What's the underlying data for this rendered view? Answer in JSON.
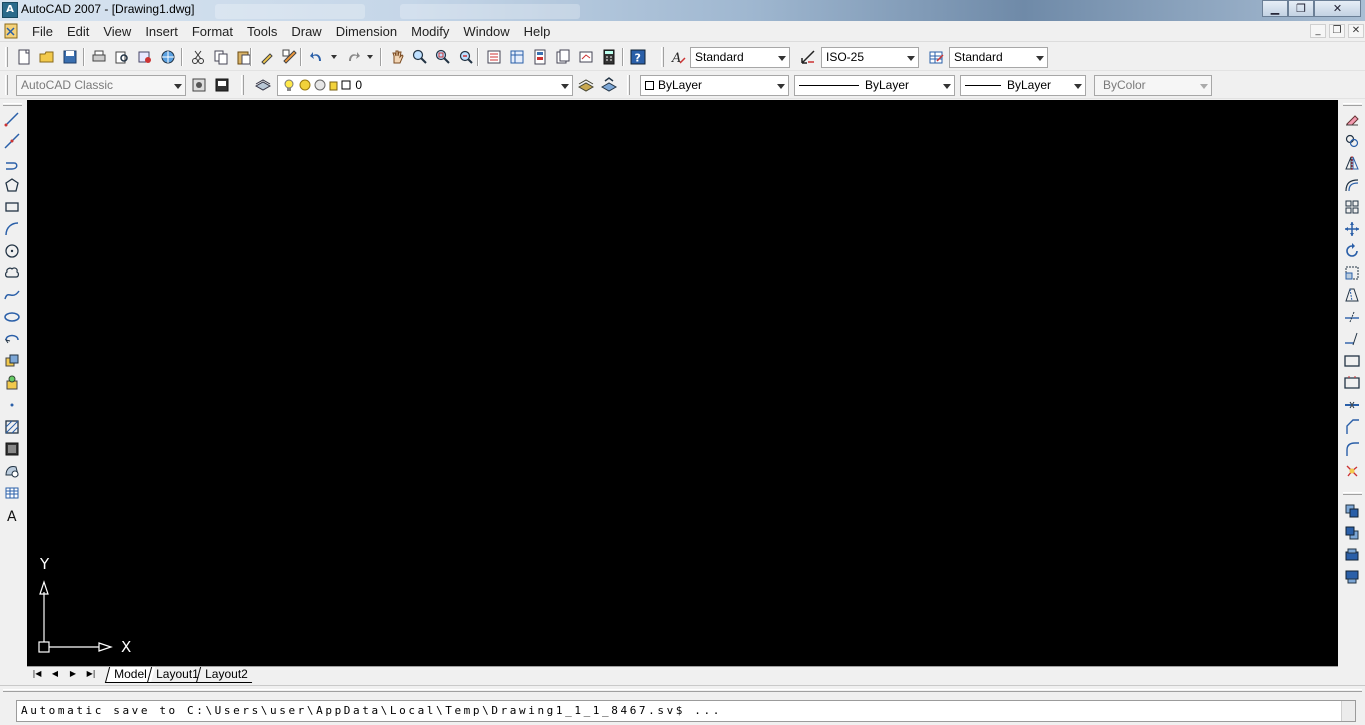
{
  "window": {
    "title": "AutoCAD 2007 - [Drawing1.dwg]",
    "controls": {
      "minimize": "▁",
      "restore": "❐",
      "close": "✕"
    },
    "mdi_controls": {
      "minimize": "_",
      "restore": "❐",
      "close": "✕"
    }
  },
  "menu": {
    "items": [
      "File",
      "Edit",
      "View",
      "Insert",
      "Format",
      "Tools",
      "Draw",
      "Dimension",
      "Modify",
      "Window",
      "Help"
    ]
  },
  "standard_toolbar": {
    "icons": [
      "new-icon",
      "open-icon",
      "save-icon",
      "plot-icon",
      "plot-preview-icon",
      "publish-icon",
      "3d-dwf-icon",
      "cut-icon",
      "copy-icon",
      "paste-icon",
      "match-properties-icon",
      "block-editor-icon",
      "undo-icon",
      "redo-icon",
      "pan-icon",
      "zoom-realtime-icon",
      "zoom-window-icon",
      "zoom-previous-icon",
      "properties-icon",
      "design-center-icon",
      "tool-palettes-icon",
      "sheet-set-icon",
      "markup-icon",
      "quickcalc-icon",
      "help-icon"
    ]
  },
  "styles_toolbar": {
    "text_style": "Standard",
    "dim_style": "ISO-25",
    "table_style": "Standard"
  },
  "workspace": {
    "value": "AutoCAD Classic"
  },
  "layers": {
    "current_layer": "0"
  },
  "properties": {
    "color": "ByLayer",
    "linetype": "ByLayer",
    "lineweight": "ByLayer",
    "plot_style": "ByColor"
  },
  "draw_toolbar": {
    "icons": [
      "line-icon",
      "construction-line-icon",
      "polyline-icon",
      "polygon-icon",
      "rectangle-icon",
      "arc-icon",
      "circle-icon",
      "revision-cloud-icon",
      "spline-icon",
      "ellipse-icon",
      "ellipse-arc-icon",
      "insert-block-icon",
      "make-block-icon",
      "point-icon",
      "hatch-icon",
      "gradient-icon",
      "region-icon",
      "table-icon",
      "multiline-text-icon"
    ],
    "text_glyph": "A"
  },
  "modify_toolbar": {
    "icons": [
      "erase-icon",
      "copy-object-icon",
      "mirror-icon",
      "offset-icon",
      "array-icon",
      "move-icon",
      "rotate-icon",
      "scale-icon",
      "stretch-icon",
      "trim-icon",
      "extend-icon",
      "break-at-point-icon",
      "break-icon",
      "join-icon",
      "chamfer-icon",
      "fillet-icon",
      "explode-icon"
    ],
    "draworder_icons": [
      "bring-to-front-icon",
      "send-to-back-icon",
      "bring-above-icon",
      "send-under-icon"
    ]
  },
  "ucs": {
    "x_label": "X",
    "y_label": "Y"
  },
  "layout_tabs": {
    "nav": [
      "|◀",
      "◀",
      "▶",
      "▶|"
    ],
    "tabs": [
      "Model",
      "Layout1",
      "Layout2"
    ],
    "active": "Model"
  },
  "command_line": {
    "text": "Automatic save to C:\\Users\\user\\AppData\\Local\\Temp\\Drawing1_1_1_8467.sv$ ..."
  },
  "colors": {
    "canvas": "#000000",
    "ui_background": "#f0f0f0"
  }
}
